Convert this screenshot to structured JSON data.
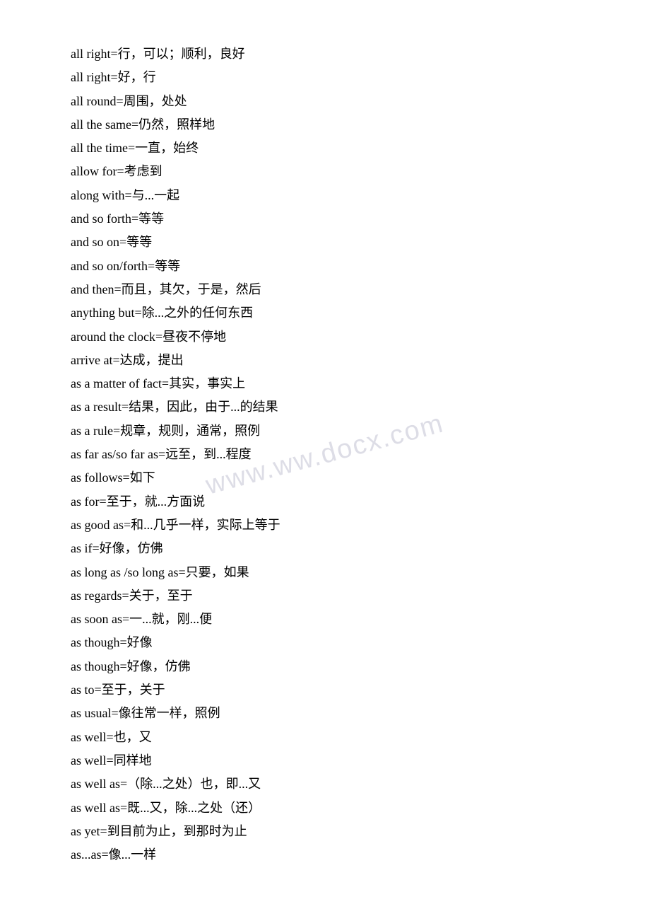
{
  "watermark": "www.ww.docx.com",
  "phrases": [
    "all right=行，可以；顺利，良好",
    "all right=好，行",
    "all round=周围，处处",
    "all the same=仍然，照样地",
    "all the time=一直，始终",
    "allow for=考虑到",
    "along with=与...一起",
    "and so forth=等等",
    "and so on=等等",
    "and so on/forth=等等",
    "and then=而且，其欠，于是，然后",
    "anything but=除...之外的任何东西",
    "around the clock=昼夜不停地",
    "arrive at=达成，提出",
    "as a matter of fact=其实，事实上",
    "as a result=结果，因此，由于...的结果",
    "as a rule=规章，规则，通常，照例",
    "as far as/so far as=远至，到...程度",
    "as follows=如下",
    "as for=至于，就...方面说",
    "as good as=和...几乎一样，实际上等于",
    "as if=好像，仿佛",
    "as long as /so long as=只要，如果",
    "as regards=关于，至于",
    "as soon as=一...就，刚...便",
    "as though=好像",
    "as though=好像，仿佛",
    "as to=至于，关于",
    "as usual=像往常一样，照例",
    "as well=也，又",
    "as well=同样地",
    "as well as=（除...之处）也，即...又",
    "as well as=既...又，除...之处（还）",
    "as yet=到目前为止，到那时为止",
    "as...as=像...一样"
  ]
}
